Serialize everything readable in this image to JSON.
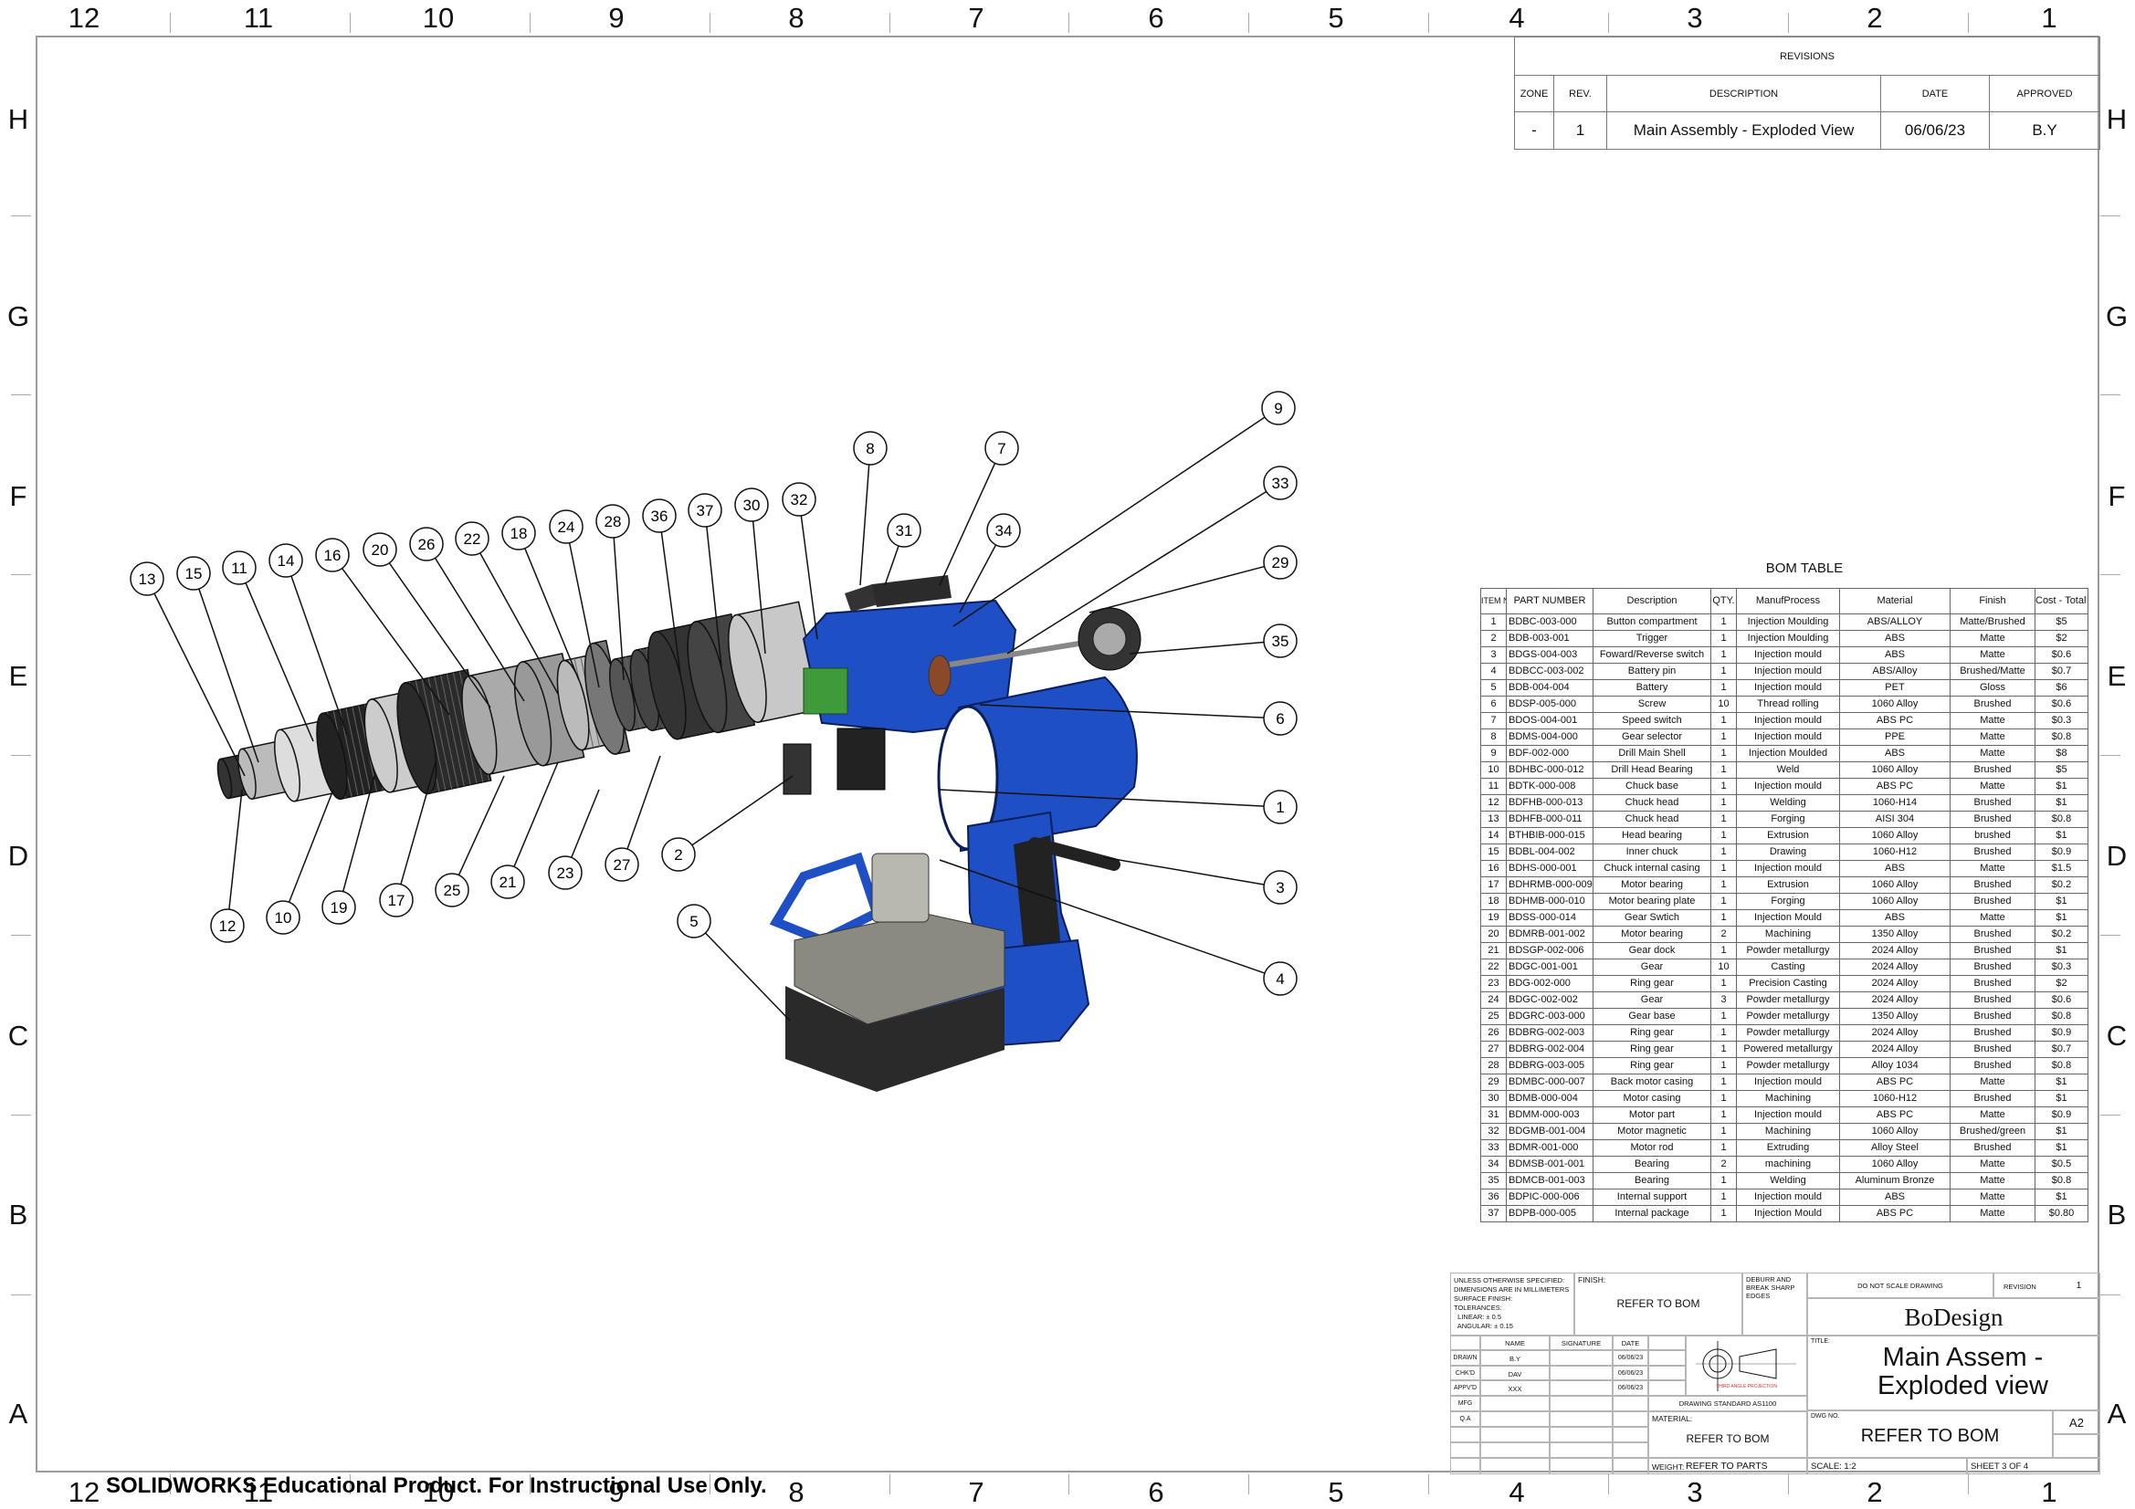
{
  "sheet": {
    "watermark": "SOLIDWORKS Educational Product. For Instructional Use Only."
  },
  "zones": {
    "columns": [
      "12",
      "11",
      "10",
      "9",
      "8",
      "7",
      "6",
      "5",
      "4",
      "3",
      "2",
      "1"
    ],
    "rows": [
      "H",
      "G",
      "F",
      "E",
      "D",
      "C",
      "B",
      "A"
    ]
  },
  "revisions": {
    "title": "REVISIONS",
    "headers": [
      "ZONE",
      "REV.",
      "DESCRIPTION",
      "DATE",
      "APPROVED"
    ],
    "rows": [
      [
        "-",
        "1",
        "Main Assembly - Exploded View",
        "06/06/23",
        "B.Y"
      ]
    ]
  },
  "bom": {
    "title": "BOM TABLE",
    "headers": [
      "ITEM NO.",
      "PART NUMBER",
      "Description",
      "QTY.",
      "ManufProcess",
      "Material",
      "Finish",
      "Cost - Total Cost"
    ],
    "rows": [
      [
        "1",
        "BDBC-003-000",
        "Button compartment",
        "1",
        "Injection Moulding",
        "ABS/ALLOY",
        "Matte/Brushed",
        "$5"
      ],
      [
        "2",
        "BDB-003-001",
        "Trigger",
        "1",
        "Injection Moulding",
        "ABS",
        "Matte",
        "$2"
      ],
      [
        "3",
        "BDGS-004-003",
        "Foward/Reverse switch",
        "1",
        "Injection mould",
        "ABS",
        "Matte",
        "$0.6"
      ],
      [
        "4",
        "BDBCC-003-002",
        "Battery pin",
        "1",
        "Injection mould",
        "ABS/Alloy",
        "Brushed/Matte",
        "$0.7"
      ],
      [
        "5",
        "BDB-004-004",
        "Battery",
        "1",
        "Injection mould",
        "PET",
        "Gloss",
        "$6"
      ],
      [
        "6",
        "BDSP-005-000",
        "Screw",
        "10",
        "Thread rolling",
        "1060 Alloy",
        "Brushed",
        "$0.6"
      ],
      [
        "7",
        "BDOS-004-001",
        "Speed switch",
        "1",
        "Injection mould",
        "ABS PC",
        "Matte",
        "$0.3"
      ],
      [
        "8",
        "BDMS-004-000",
        "Gear selector",
        "1",
        "Injection mould",
        "PPE",
        "Matte",
        "$0.8"
      ],
      [
        "9",
        "BDF-002-000",
        "Drill Main Shell",
        "1",
        "Injection Moulded",
        "ABS",
        "Matte",
        "$8"
      ],
      [
        "10",
        "BDHBC-000-012",
        "Drill Head Bearing",
        "1",
        "Weld",
        "1060 Alloy",
        "Brushed",
        "$5"
      ],
      [
        "11",
        "BDTK-000-008",
        "Chuck base",
        "1",
        "Injection mould",
        "ABS PC",
        "Matte",
        "$1"
      ],
      [
        "12",
        "BDFHB-000-013",
        "Chuck head",
        "1",
        "Welding",
        "1060-H14",
        "Brushed",
        "$1"
      ],
      [
        "13",
        "BDHFB-000-011",
        "Chuck head",
        "1",
        "Forging",
        "AISI 304",
        "Brushed",
        "$0.8"
      ],
      [
        "14",
        "BTHBIB-000-015",
        "Head bearing",
        "1",
        "Extrusion",
        "1060 Alloy",
        "brushed",
        "$1"
      ],
      [
        "15",
        "BDBL-004-002",
        "Inner chuck",
        "1",
        "Drawing",
        "1060-H12",
        "Brushed",
        "$0.9"
      ],
      [
        "16",
        "BDHS-000-001",
        "Chuck internal casing",
        "1",
        "Injection mould",
        "ABS",
        "Matte",
        "$1.5"
      ],
      [
        "17",
        "BDHRMB-000-009",
        "Motor bearing",
        "1",
        "Extrusion",
        "1060 Alloy",
        "Brushed",
        "$0.2"
      ],
      [
        "18",
        "BDHMB-000-010",
        "Motor bearing plate",
        "1",
        "Forging",
        "1060 Alloy",
        "Brushed",
        "$1"
      ],
      [
        "19",
        "BDSS-000-014",
        "Gear Swtich",
        "1",
        "Injection Mould",
        "ABS",
        "Matte",
        "$1"
      ],
      [
        "20",
        "BDMRB-001-002",
        "Motor bearing",
        "2",
        "Machining",
        "1350 Alloy",
        "Brushed",
        "$0.2"
      ],
      [
        "21",
        "BDSGP-002-006",
        "Gear dock",
        "1",
        "Powder metallurgy",
        "2024 Alloy",
        "Brushed",
        "$1"
      ],
      [
        "22",
        "BDGC-001-001",
        "Gear",
        "10",
        "Casting",
        "2024 Alloy",
        "Brushed",
        "$0.3"
      ],
      [
        "23",
        "BDG-002-000",
        "Ring gear",
        "1",
        "Precision Casting",
        "2024 Alloy",
        "Brushed",
        "$2"
      ],
      [
        "24",
        "BDGC-002-002",
        "Gear",
        "3",
        "Powder metallurgy",
        "2024 Alloy",
        "Brushed",
        "$0.6"
      ],
      [
        "25",
        "BDGRC-003-000",
        "Gear base",
        "1",
        "Powder metallurgy",
        "1350 Alloy",
        "Brushed",
        "$0.8"
      ],
      [
        "26",
        "BDBRG-002-003",
        "Ring gear",
        "1",
        "Powder metallurgy",
        "2024 Alloy",
        "Brushed",
        "$0.9"
      ],
      [
        "27",
        "BDBRG-002-004",
        "Ring gear",
        "1",
        "Powered metallurgy",
        "2024 Alloy",
        "Brushed",
        "$0.7"
      ],
      [
        "28",
        "BDBRG-003-005",
        "Ring gear",
        "1",
        "Powder metallurgy",
        "Alloy 1034",
        "Brushed",
        "$0.8"
      ],
      [
        "29",
        "BDMBC-000-007",
        "Back motor casing",
        "1",
        "Injection mould",
        "ABS PC",
        "Matte",
        "$1"
      ],
      [
        "30",
        "BDMB-000-004",
        "Motor casing",
        "1",
        "Machining",
        "1060-H12",
        "Brushed",
        "$1"
      ],
      [
        "31",
        "BDMM-000-003",
        "Motor part",
        "1",
        "Injection mould",
        "ABS PC",
        "Matte",
        "$0.9"
      ],
      [
        "32",
        "BDGMB-001-004",
        "Motor magnetic",
        "1",
        "Machining",
        "1060 Alloy",
        "Brushed/green",
        "$1"
      ],
      [
        "33",
        "BDMR-001-000",
        "Motor rod",
        "1",
        "Extruding",
        "Alloy Steel",
        "Brushed",
        "$1"
      ],
      [
        "34",
        "BDMSB-001-001",
        "Bearing",
        "2",
        "machining",
        "1060 Alloy",
        "Matte",
        "$0.5"
      ],
      [
        "35",
        "BDMCB-001-003",
        "Bearing",
        "1",
        "Welding",
        "Aluminum Bronze",
        "Matte",
        "$0.8"
      ],
      [
        "36",
        "BDPIC-000-006",
        "Internal support",
        "1",
        "Injection mould",
        "ABS",
        "Matte",
        "$1"
      ],
      [
        "37",
        "BDPB-000-005",
        "Internal package",
        "1",
        "Injection Mould",
        "ABS PC",
        "Matte",
        "$0.80"
      ]
    ]
  },
  "title_block": {
    "notes": [
      "UNLESS OTHERWISE SPECIFIED:",
      "DIMENSIONS ARE IN MILLIMETERS",
      "SURFACE FINISH:",
      "TOLERANCES:",
      "  LINEAR: ± 0.5",
      "  ANGULAR: ± 0.15"
    ],
    "finish_label": "FINISH:",
    "finish_value": "REFER TO BOM",
    "deburr": "DEBURR AND BREAK SHARP EDGES",
    "do_not_scale": "DO NOT SCALE DRAWING",
    "revision_label": "REVISION",
    "revision_value": "1",
    "company": "BoDesign",
    "title_label": "TITLE:",
    "title": "Main Assem - Exploded view",
    "sign_headers": [
      "NAME",
      "SIGNATURE",
      "DATE"
    ],
    "sign_rows": [
      {
        "role": "DRAWN",
        "name": "B.Y",
        "date": "06/06/23"
      },
      {
        "role": "CHK'D",
        "name": "DAV",
        "date": "06/06/23"
      },
      {
        "role": "APPV'D",
        "name": "XXX",
        "date": "06/06/23"
      },
      {
        "role": "MFG"
      },
      {
        "role": "Q.A"
      }
    ],
    "projection_label": "THIRD ANGLE PROJECTION",
    "drawing_standard": "DRAWING STANDARD AS1100",
    "material_label": "MATERIAL:",
    "material_value": "REFER TO BOM",
    "weight_label": "WEIGHT:",
    "weight_value": "REFER TO PARTS",
    "dwg_no_label": "DWG NO.",
    "dwg_no_value": "REFER TO BOM",
    "size": "A2",
    "scale": "SCALE: 1:2",
    "sheet": "SHEET 3 OF 4"
  },
  "balloons": [
    "13",
    "15",
    "11",
    "14",
    "16",
    "20",
    "26",
    "22",
    "18",
    "24",
    "28",
    "36",
    "37",
    "30",
    "32",
    "8",
    "7",
    "31",
    "34",
    "9",
    "33",
    "29",
    "35",
    "6",
    "1",
    "3",
    "4",
    "5",
    "2",
    "27",
    "23",
    "21",
    "25",
    "17",
    "19",
    "10",
    "12"
  ],
  "colors": {
    "body_blue": "#1f4fc4",
    "border": "#9a9a9a"
  }
}
